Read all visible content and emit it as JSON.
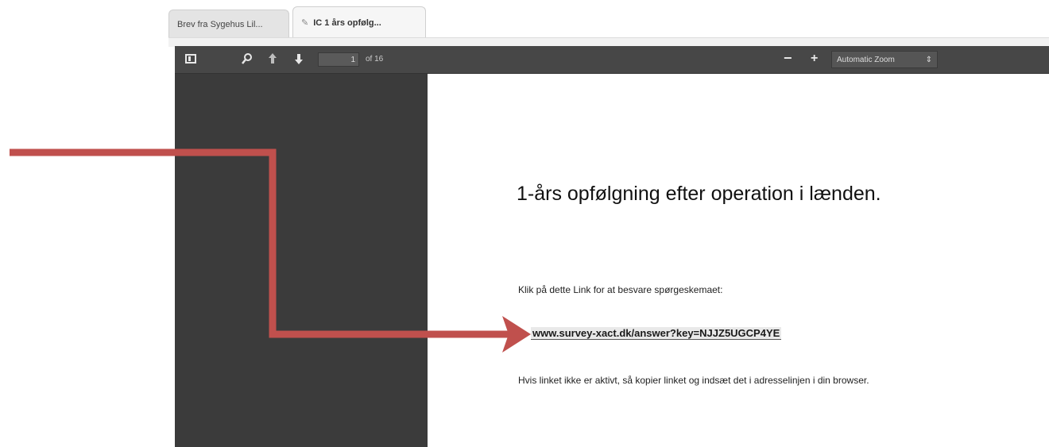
{
  "tabs": [
    {
      "label": "Brev fra Sygehus Lil...",
      "active": false
    },
    {
      "label": "IC 1 års opfølg...",
      "active": true,
      "icon": "paperclip-icon"
    }
  ],
  "toolbar": {
    "page_number": "1",
    "page_count": "of 16",
    "zoom": "Automatic Zoom",
    "zoom_caret": "⇕",
    "zoom_minus": "−",
    "zoom_plus": "+"
  },
  "document": {
    "heading": "1-års opfølgning efter operation i lænden.",
    "instruction": "Klik på dette Link for at besvare spørgeskemaet:",
    "link": "www.survey-xact.dk/answer?key=NJJZ5UGCP4YE",
    "note": "Hvis linket ikke er aktivt, så kopier linket og indsæt det i adresselinjen i din browser."
  },
  "annotation": {
    "arrow_color": "#c0504d"
  }
}
